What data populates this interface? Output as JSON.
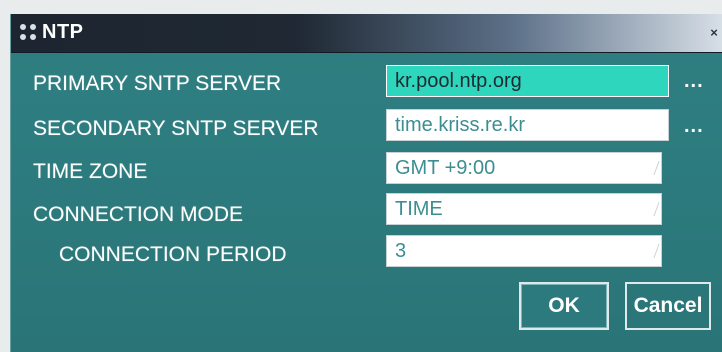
{
  "window": {
    "title": "NTP",
    "close_label": "×"
  },
  "fields": [
    {
      "label": "PRIMARY SNTP SERVER",
      "value": "kr.pool.ntp.org",
      "more": "..."
    },
    {
      "label": "SECONDARY SNTP SERVER",
      "value": "time.kriss.re.kr",
      "more": "..."
    },
    {
      "label": "TIME ZONE",
      "value": "GMT +9:00"
    },
    {
      "label": "CONNECTION MODE",
      "value": "TIME"
    },
    {
      "label": "CONNECTION PERIOD",
      "value": "3"
    }
  ],
  "buttons": {
    "ok": "OK",
    "cancel": "Cancel"
  },
  "colors": {
    "dialog_bg": "#2c7a7d",
    "active_field": "#2fd6be",
    "field_text": "#3d8e93"
  }
}
